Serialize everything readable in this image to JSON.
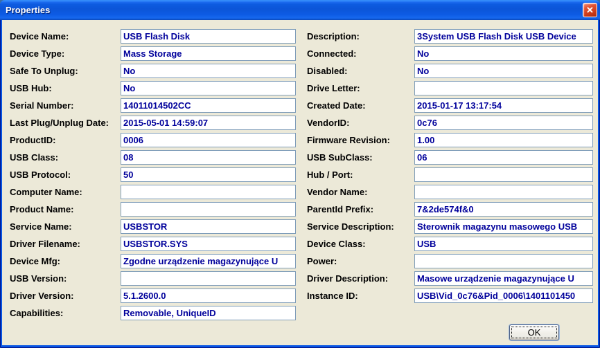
{
  "window": {
    "title": "Properties",
    "close_icon": "✕"
  },
  "colors": {
    "titlebar_blue": "#0C55D8",
    "frame_blue": "#0855E3",
    "dialog_face": "#ECE9D8",
    "field_border": "#7F9DB9",
    "field_text": "#00009B",
    "close_red": "#CC3A17"
  },
  "fields": {
    "left": [
      {
        "label": "Device Name:",
        "value": "USB Flash Disk"
      },
      {
        "label": "Device Type:",
        "value": "Mass Storage"
      },
      {
        "label": "Safe To Unplug:",
        "value": "No"
      },
      {
        "label": "USB Hub:",
        "value": "No"
      },
      {
        "label": "Serial Number:",
        "value": "14011014502CC"
      },
      {
        "label": "Last Plug/Unplug Date:",
        "value": "2015-05-01 14:59:07"
      },
      {
        "label": "ProductID:",
        "value": "0006"
      },
      {
        "label": "USB Class:",
        "value": "08"
      },
      {
        "label": "USB Protocol:",
        "value": "50"
      },
      {
        "label": "Computer Name:",
        "value": ""
      },
      {
        "label": "Product Name:",
        "value": ""
      },
      {
        "label": "Service Name:",
        "value": "USBSTOR"
      },
      {
        "label": "Driver Filename:",
        "value": "USBSTOR.SYS"
      },
      {
        "label": "Device Mfg:",
        "value": "Zgodne urządzenie magazynujące U"
      },
      {
        "label": "USB Version:",
        "value": ""
      },
      {
        "label": "Driver Version:",
        "value": "5.1.2600.0"
      },
      {
        "label": "Capabilities:",
        "value": "Removable, UniqueID"
      }
    ],
    "right": [
      {
        "label": "Description:",
        "value": "3System USB Flash Disk USB Device"
      },
      {
        "label": "Connected:",
        "value": "No"
      },
      {
        "label": "Disabled:",
        "value": "No"
      },
      {
        "label": "Drive Letter:",
        "value": ""
      },
      {
        "label": "Created Date:",
        "value": "2015-01-17 13:17:54"
      },
      {
        "label": "VendorID:",
        "value": "0c76"
      },
      {
        "label": "Firmware Revision:",
        "value": "1.00"
      },
      {
        "label": "USB SubClass:",
        "value": "06"
      },
      {
        "label": "Hub / Port:",
        "value": ""
      },
      {
        "label": "Vendor Name:",
        "value": ""
      },
      {
        "label": "ParentId Prefix:",
        "value": "7&2de574f&0"
      },
      {
        "label": "Service Description:",
        "value": "Sterownik magazynu masowego USB"
      },
      {
        "label": "Device Class:",
        "value": "USB"
      },
      {
        "label": "Power:",
        "value": ""
      },
      {
        "label": "Driver Description:",
        "value": "Masowe urządzenie magazynujące U"
      },
      {
        "label": "Instance ID:",
        "value": "USB\\Vid_0c76&Pid_0006\\1401101450"
      }
    ]
  },
  "buttons": {
    "ok_label": "OK"
  }
}
